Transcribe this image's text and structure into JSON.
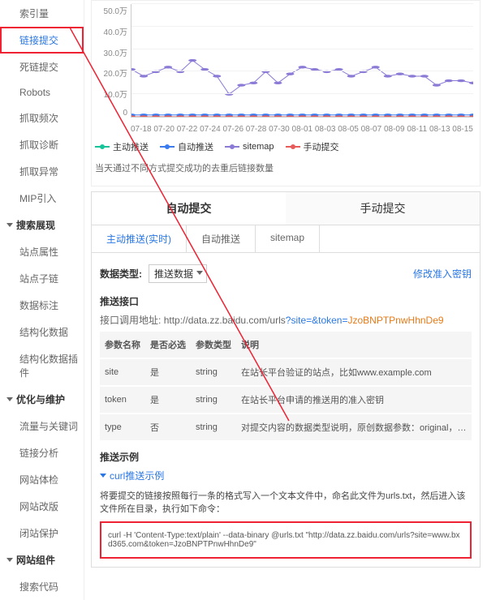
{
  "sidebar": {
    "items": [
      {
        "label": "索引量"
      },
      {
        "label": "链接提交"
      },
      {
        "label": "死链提交"
      },
      {
        "label": "Robots"
      },
      {
        "label": "抓取频次"
      },
      {
        "label": "抓取诊断"
      },
      {
        "label": "抓取异常"
      },
      {
        "label": "MIP引入"
      }
    ],
    "groups": [
      {
        "title": "搜索展现",
        "items": [
          {
            "label": "站点属性"
          },
          {
            "label": "站点子链"
          },
          {
            "label": "数据标注"
          },
          {
            "label": "结构化数据"
          },
          {
            "label": "结构化数据插件"
          }
        ]
      },
      {
        "title": "优化与维护",
        "items": [
          {
            "label": "流量与关键词"
          },
          {
            "label": "链接分析"
          },
          {
            "label": "网站体检"
          },
          {
            "label": "网站改版"
          },
          {
            "label": "闭站保护"
          }
        ]
      },
      {
        "title": "网站组件",
        "items": [
          {
            "label": "搜索代码"
          }
        ]
      }
    ]
  },
  "chart_data": {
    "type": "line",
    "title": "",
    "xlabel": "",
    "ylabel": "",
    "ylim": [
      0,
      50
    ],
    "y_ticks": [
      "0",
      "10.0万",
      "20.0万",
      "30.0万",
      "40.0万",
      "50.0万"
    ],
    "categories": [
      "07-18",
      "07-20",
      "07-22",
      "07-24",
      "07-26",
      "07-28",
      "07-30",
      "08-01",
      "08-03",
      "08-05",
      "08-07",
      "08-09",
      "08-11",
      "08-13",
      "08-15"
    ],
    "series": [
      {
        "name": "主动推送",
        "color": "#17c49a",
        "values": [
          0,
          0,
          0,
          0,
          0,
          0,
          0,
          0,
          0,
          0,
          0,
          0,
          0,
          0,
          0,
          0,
          0,
          0,
          0,
          0,
          0,
          0,
          0,
          0,
          0,
          0,
          0,
          0,
          0
        ]
      },
      {
        "name": "自动推送",
        "color": "#3b7bf0",
        "values": [
          0.8,
          0.8,
          0.8,
          0.8,
          0.8,
          0.8,
          0.8,
          0.8,
          0.8,
          0.8,
          0.8,
          0.8,
          0.8,
          0.8,
          0.8,
          0.8,
          0.8,
          0.8,
          0.8,
          0.8,
          0.8,
          0.8,
          0.8,
          0.8,
          0.8,
          0.8,
          0.8,
          0.8,
          0.8
        ]
      },
      {
        "name": "sitemap",
        "color": "#8b7ad6",
        "values": [
          21,
          18,
          20,
          22,
          20,
          25,
          21,
          18,
          10,
          14,
          15,
          20,
          15,
          19,
          22,
          21,
          20,
          21,
          18,
          20,
          22,
          18,
          19,
          18,
          18,
          14,
          16,
          16,
          15
        ]
      },
      {
        "name": "手动提交",
        "color": "#e85b5b",
        "values": [
          0,
          0,
          0,
          0,
          0,
          0,
          0,
          0,
          0,
          0,
          0,
          0,
          0,
          0,
          0,
          0,
          0,
          0,
          0,
          0,
          0,
          0,
          0,
          0,
          0,
          0,
          0,
          0,
          0
        ]
      }
    ]
  },
  "chart_note": "当天通过不同方式提交成功的去重后链接数量",
  "tabs": {
    "auto": "自动提交",
    "manual": "手动提交"
  },
  "subtabs": {
    "active": "主动推送(实时)",
    "auto": "自动推送",
    "sitemap": "sitemap"
  },
  "data_type": {
    "label": "数据类型:",
    "value": "推送数据"
  },
  "modify_pw": "修改准入密钥",
  "api": {
    "title": "推送接口",
    "prefix": "接口调用地址:",
    "base": "http://data.zz.baidu.com/urls",
    "site_key": "?site=",
    "site_val": "",
    "token_key": "&token=",
    "token_val": "JzoBNPTPnwHhnDe9"
  },
  "params": {
    "headers": [
      "参数名称",
      "是否必选",
      "参数类型",
      "说明"
    ],
    "rows": [
      {
        "name": "site",
        "required": "是",
        "type": "string",
        "desc": "在站长平台验证的站点，比如www.example.com"
      },
      {
        "name": "token",
        "required": "是",
        "type": "string",
        "desc": "在站长平台申请的推送用的准入密钥"
      },
      {
        "name": "type",
        "required": "否",
        "type": "string",
        "desc": "对提交内容的数据类型说明，原创数据参数：original，请提交真实原创内容"
      }
    ]
  },
  "example": {
    "title": "推送示例",
    "curl": "curl推送示例"
  },
  "instruction": "将要提交的链接按照每行一条的格式写入一个文本文件中，命名此文件为urls.txt，然后进入该文件所在目录，执行如下命令：",
  "code": "curl -H 'Content-Type:text/plain' --data-binary @urls.txt \"http://data.zz.baidu.com/urls?site=www.bxd365.com&token=JzoBNPTPnwHhnDe9\""
}
